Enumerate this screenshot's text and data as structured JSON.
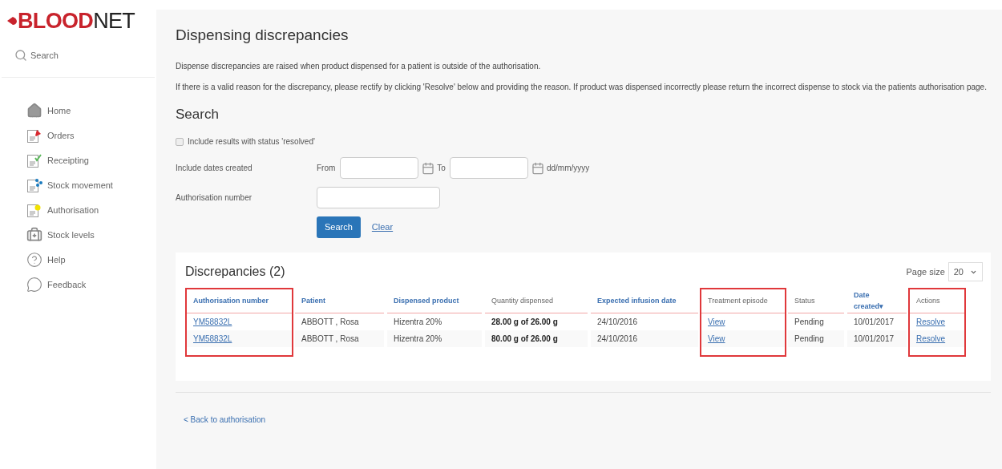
{
  "logo": {
    "strong": "BLOOD",
    "light": "NET"
  },
  "sidebar": {
    "search": "Search",
    "items": [
      {
        "label": "Home",
        "kind": "home"
      },
      {
        "label": "Orders",
        "kind": "orders"
      },
      {
        "label": "Receipting",
        "kind": "receipting"
      },
      {
        "label": "Stock movement",
        "kind": "movement"
      },
      {
        "label": "Authorisation",
        "kind": "authorisation"
      },
      {
        "label": "Stock levels",
        "kind": "levels"
      },
      {
        "label": "Help",
        "kind": "help"
      },
      {
        "label": "Feedback",
        "kind": "feedback"
      }
    ]
  },
  "page": {
    "title": "Dispensing discrepancies",
    "intro": [
      "Dispense discrepancies are raised when product dispensed for a patient is outside of the authorisation.",
      "If there is a valid reason for the discrepancy, please rectify by clicking 'Resolve' below and providing the reason. If product was dispensed incorrectly please return the incorrect dispense to stock via the patients authorisation page."
    ]
  },
  "search": {
    "title": "Search",
    "include_resolved": {
      "label": "Include results with status 'resolved'",
      "checked": false
    },
    "dates_label": "Include dates created",
    "from_label": "From",
    "to_label": "To",
    "date_format": "dd/mm/yyyy",
    "auth_label": "Authorisation number",
    "search_button": "Search",
    "clear_link": "Clear"
  },
  "results": {
    "title": "Discrepancies (2)",
    "page_size_label": "Page size",
    "page_size": "20",
    "columns": [
      {
        "label": "Authorisation number",
        "sortable": true,
        "highlighted": true,
        "kind": "link"
      },
      {
        "label": "Patient",
        "sortable": true,
        "highlighted": false,
        "kind": "text"
      },
      {
        "label": "Dispensed product",
        "sortable": true,
        "highlighted": false,
        "kind": "text"
      },
      {
        "label": "Quantity dispensed",
        "sortable": false,
        "highlighted": false,
        "kind": "bold"
      },
      {
        "label": "Expected infusion date",
        "sortable": true,
        "highlighted": false,
        "kind": "text"
      },
      {
        "label": "Treatment episode",
        "sortable": false,
        "highlighted": true,
        "kind": "link"
      },
      {
        "label": "Status",
        "sortable": false,
        "highlighted": false,
        "kind": "text"
      },
      {
        "label": "Date created▾",
        "sortable": true,
        "highlighted": false,
        "kind": "text"
      },
      {
        "label": "Actions",
        "sortable": false,
        "highlighted": true,
        "kind": "link"
      }
    ],
    "rows": [
      [
        "YM58832L",
        "ABBOTT , Rosa",
        "Hizentra 20%",
        "28.00 g of 26.00 g",
        "24/10/2016",
        "View",
        "Pending",
        "10/01/2017",
        "Resolve"
      ],
      [
        "YM58832L",
        "ABBOTT , Rosa",
        "Hizentra 20%",
        "80.00 g of 26.00 g",
        "24/10/2016",
        "View",
        "Pending",
        "10/01/2017",
        "Resolve"
      ]
    ]
  },
  "back_link": "< Back to authorisation"
}
